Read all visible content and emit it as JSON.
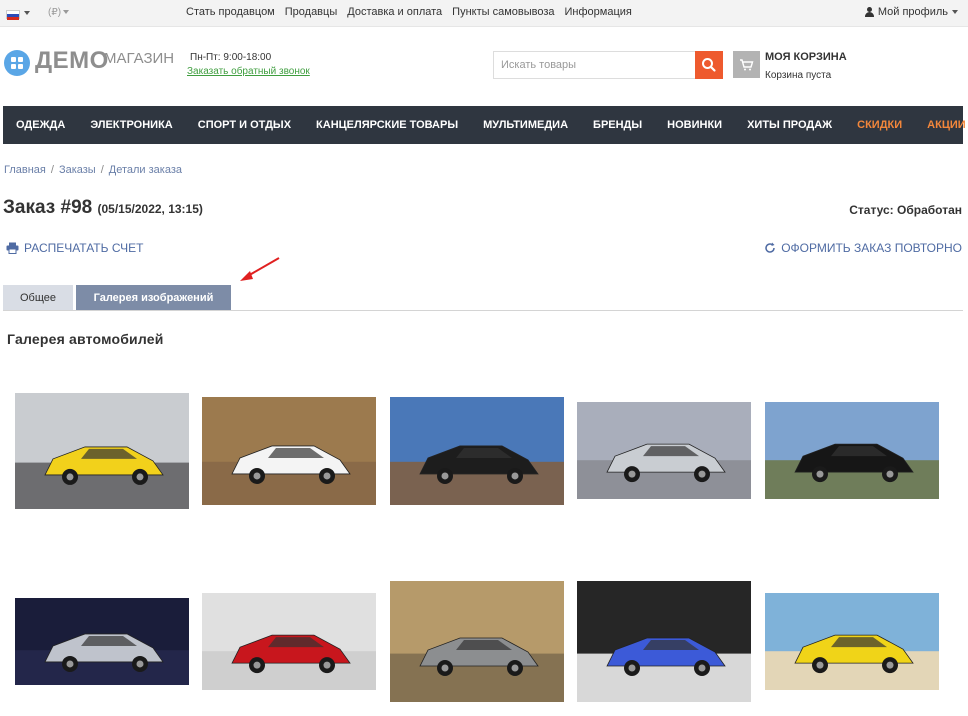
{
  "topbar": {
    "language_icon": "ru-flag-icon",
    "currency": "(₽)",
    "links": [
      "Стать продавцом",
      "Продавцы",
      "Доставка и оплата",
      "Пункты самовывоза",
      "Информация"
    ],
    "profile_label": "Мой профиль"
  },
  "header": {
    "logo_bold": "ДЕМО",
    "logo_light": "МАГАЗИН",
    "hours": "Пн-Пт: 9:00-18:00",
    "callback": "Заказать обратный звонок",
    "search_placeholder": "Искать товары",
    "cart_title": "МОЯ КОРЗИНА",
    "cart_status": "Корзина пуста"
  },
  "nav": {
    "items": [
      {
        "label": "ОДЕЖДА",
        "hot": false
      },
      {
        "label": "ЭЛЕКТРОНИКА",
        "hot": false
      },
      {
        "label": "СПОРТ И ОТДЫХ",
        "hot": false
      },
      {
        "label": "КАНЦЕЛЯРСКИЕ ТОВАРЫ",
        "hot": false
      },
      {
        "label": "МУЛЬТИМЕДИА",
        "hot": false
      },
      {
        "label": "БРЕНДЫ",
        "hot": false
      },
      {
        "label": "НОВИНКИ",
        "hot": false
      },
      {
        "label": "ХИТЫ ПРОДАЖ",
        "hot": false
      },
      {
        "label": "СКИДКИ",
        "hot": true
      },
      {
        "label": "АКЦИИ",
        "hot": true
      }
    ]
  },
  "breadcrumb": [
    "Главная",
    "Заказы",
    "Детали заказа"
  ],
  "order": {
    "title": "Заказ #98",
    "date": "(05/15/2022, 13:15)",
    "status": "Статус: Обработан",
    "print_label": "РАСПЕЧАТАТЬ СЧЕТ",
    "repeat_label": "ОФОРМИТЬ ЗАКАЗ ПОВТОРНО"
  },
  "tabs": {
    "general": "Общее",
    "gallery": "Галерея изображений"
  },
  "gallery": {
    "title": "Галерея автомобилей",
    "images": [
      {
        "name": "yellow-lamborghini",
        "sky": "#c9ccd0",
        "ground": "#6d6d70",
        "car": "#f2d11b"
      },
      {
        "name": "white-bmw",
        "sky": "#9c7a4e",
        "ground": "#8a6a48",
        "car": "#f4f4f4"
      },
      {
        "name": "black-toyota-suv",
        "sky": "#4a78b8",
        "ground": "#7a6250",
        "car": "#1d1d1d"
      },
      {
        "name": "silver-audi",
        "sky": "#a9aebb",
        "ground": "#8e9098",
        "car": "#c9cdd2"
      },
      {
        "name": "black-bmw",
        "sky": "#7ea3cf",
        "ground": "#6f7d5a",
        "car": "#161616"
      },
      {
        "name": "silver-mercedes-concept",
        "sky": "#1a1d3a",
        "ground": "#23264a",
        "car": "#bfc3cc"
      },
      {
        "name": "red-ferrari",
        "sky": "#e0e0e0",
        "ground": "#cfcfcf",
        "car": "#c8161d"
      },
      {
        "name": "grey-pagani",
        "sky": "#b69a6a",
        "ground": "#857252",
        "car": "#8c8e90"
      },
      {
        "name": "blue-koenigsegg",
        "sky": "#262626",
        "ground": "#d8d8d8",
        "car": "#3c5ad8"
      },
      {
        "name": "yellow-ferrari",
        "sky": "#7fb2d9",
        "ground": "#e3d6b7",
        "car": "#f0d418"
      }
    ]
  }
}
